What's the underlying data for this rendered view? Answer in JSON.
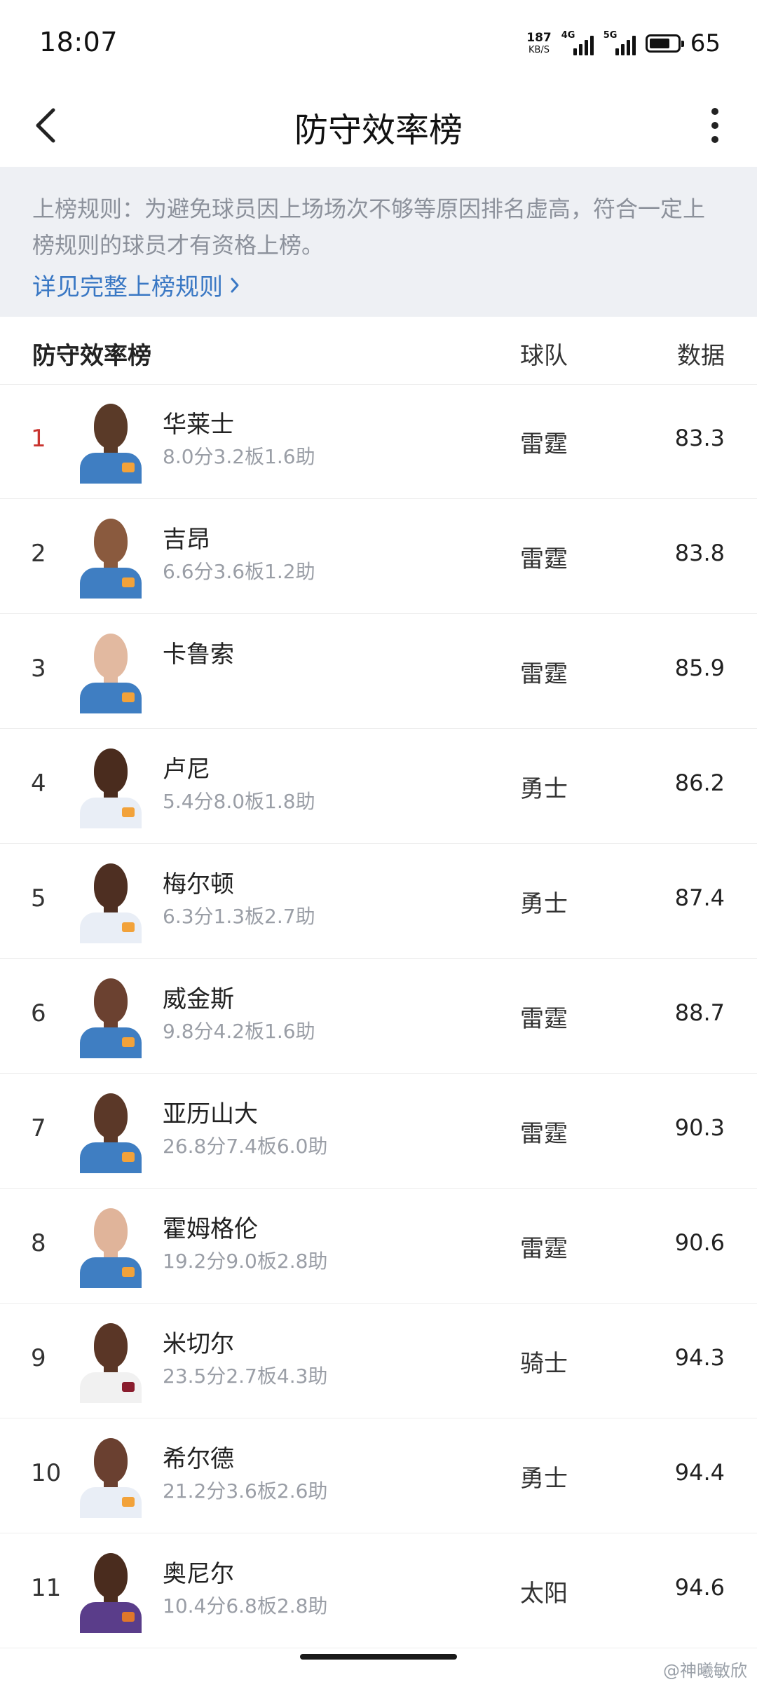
{
  "status": {
    "time": "18:07",
    "net_speed_value": "187",
    "net_speed_unit": "KB/S",
    "sim1_label": "4G",
    "sim2_label": "5G",
    "battery": "65"
  },
  "header": {
    "title": "防守效率榜",
    "back_icon": "chevron-left-icon",
    "more_icon": "more-vertical-icon"
  },
  "notice": {
    "text": "上榜规则：为避免球员因上场场次不够等原因排名虚高，符合一定上榜规则的球员才有资格上榜。",
    "link_label": "详见完整上榜规则"
  },
  "table": {
    "title": "防守效率榜",
    "col_team": "球队",
    "col_data": "数据",
    "rows": [
      {
        "rank": "1",
        "name": "华莱士",
        "stats": "8.0分3.2板1.6助",
        "team": "雷霆",
        "value": "83.3",
        "skin": "#5a3a28",
        "jersey": "#3f7ec2"
      },
      {
        "rank": "2",
        "name": "吉昂",
        "stats": "6.6分3.6板1.2助",
        "team": "雷霆",
        "value": "83.8",
        "skin": "#8a5a3e",
        "jersey": "#3f7ec2"
      },
      {
        "rank": "3",
        "name": "卡鲁索",
        "stats": "",
        "team": "雷霆",
        "value": "85.9",
        "skin": "#e2b9a0",
        "jersey": "#3f7ec2"
      },
      {
        "rank": "4",
        "name": "卢尼",
        "stats": "5.4分8.0板1.8助",
        "team": "勇士",
        "value": "86.2",
        "skin": "#4a2c1e",
        "jersey": "#e9eef6"
      },
      {
        "rank": "5",
        "name": "梅尔顿",
        "stats": "6.3分1.3板2.7助",
        "team": "勇士",
        "value": "87.4",
        "skin": "#4e2f22",
        "jersey": "#e9eef6"
      },
      {
        "rank": "6",
        "name": "威金斯",
        "stats": "9.8分4.2板1.6助",
        "team": "雷霆",
        "value": "88.7",
        "skin": "#6b4130",
        "jersey": "#3f7ec2"
      },
      {
        "rank": "7",
        "name": "亚历山大",
        "stats": "26.8分7.4板6.0助",
        "team": "雷霆",
        "value": "90.3",
        "skin": "#5b3828",
        "jersey": "#3f7ec2"
      },
      {
        "rank": "8",
        "name": "霍姆格伦",
        "stats": "19.2分9.0板2.8助",
        "team": "雷霆",
        "value": "90.6",
        "skin": "#e0b49a",
        "jersey": "#3f7ec2"
      },
      {
        "rank": "9",
        "name": "米切尔",
        "stats": "23.5分2.7板4.3助",
        "team": "骑士",
        "value": "94.3",
        "skin": "#5a3626",
        "jersey": "#f1f1f1"
      },
      {
        "rank": "10",
        "name": "希尔德",
        "stats": "21.2分3.6板2.6助",
        "team": "勇士",
        "value": "94.4",
        "skin": "#6a4030",
        "jersey": "#e9eef6"
      },
      {
        "rank": "11",
        "name": "奥尼尔",
        "stats": "10.4分6.8板2.8助",
        "team": "太阳",
        "value": "94.6",
        "skin": "#4a2c1e",
        "jersey": "#5a3d8a"
      }
    ]
  },
  "watermark": "@神曦敏欣",
  "colors": {
    "rank_highlight": "#c9342f",
    "link": "#3a78c4",
    "notice_bg": "#eef0f4"
  }
}
